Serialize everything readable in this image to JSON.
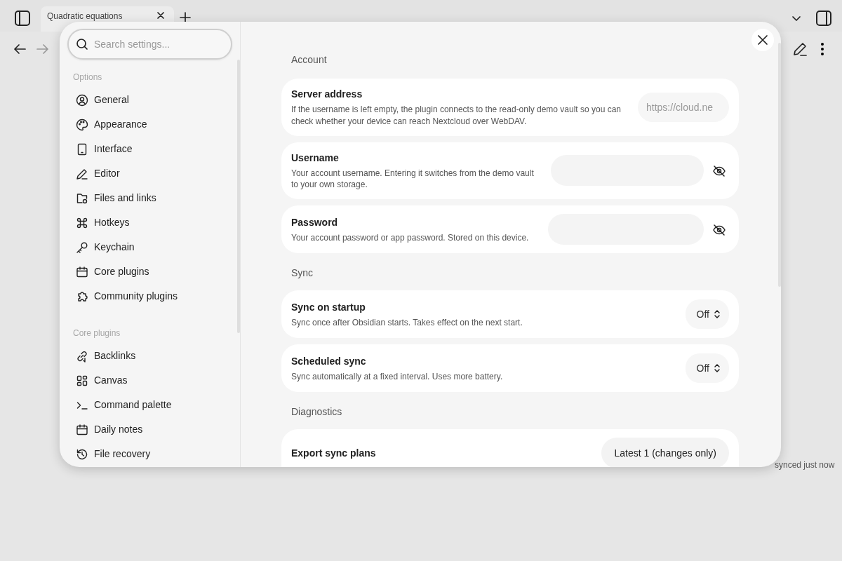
{
  "app": {
    "tabs": [
      {
        "title": "Quadratic equations",
        "selected": true
      }
    ],
    "status_bar": "synced just now"
  },
  "settings": {
    "search": {
      "placeholder": "Search settings..."
    },
    "sidebar": [
      {
        "heading": "Options",
        "items": [
          {
            "label": "General",
            "selected": false
          },
          {
            "label": "Appearance",
            "selected": false
          },
          {
            "label": "Interface",
            "selected": false
          },
          {
            "label": "Editor",
            "selected": false
          },
          {
            "label": "Files and links",
            "selected": false
          },
          {
            "label": "Hotkeys",
            "selected": false
          },
          {
            "label": "Keychain",
            "selected": false
          },
          {
            "label": "Core plugins",
            "selected": false
          },
          {
            "label": "Community plugins",
            "selected": false
          }
        ]
      },
      {
        "heading": "Core plugins",
        "items": [
          {
            "label": "Backlinks",
            "selected": false
          },
          {
            "label": "Canvas",
            "selected": false
          },
          {
            "label": "Command palette",
            "selected": false
          },
          {
            "label": "Daily notes",
            "selected": false
          },
          {
            "label": "File recovery",
            "selected": false
          }
        ]
      }
    ],
    "sections": [
      {
        "heading": "Account",
        "settings": [
          {
            "kind": "text",
            "name": "Server address",
            "description": "If the username is left empty, the plugin connects to the read-only demo vault so you can check whether your device can reach Nextcloud over WebDAV.",
            "placeholder": "https://cloud.ne"
          },
          {
            "kind": "secret",
            "name": "Username",
            "description": "Your account username. Entering it switches from the demo vault to your own storage."
          },
          {
            "kind": "secret",
            "name": "Password",
            "description": "Your account password or app password. Stored on this device."
          }
        ]
      },
      {
        "heading": "Sync",
        "settings": [
          {
            "kind": "select",
            "name": "Sync on startup",
            "description": "Sync once after Obsidian starts. Takes effect on the next start.",
            "value": "Off"
          },
          {
            "kind": "select",
            "name": "Scheduled sync",
            "description": "Sync automatically at a fixed interval. Uses more battery.",
            "value": "Off"
          }
        ]
      },
      {
        "heading": "Diagnostics",
        "settings": [
          {
            "kind": "button",
            "name": "Export sync plans",
            "value": "Latest 1 (changes only)"
          }
        ]
      }
    ]
  }
}
